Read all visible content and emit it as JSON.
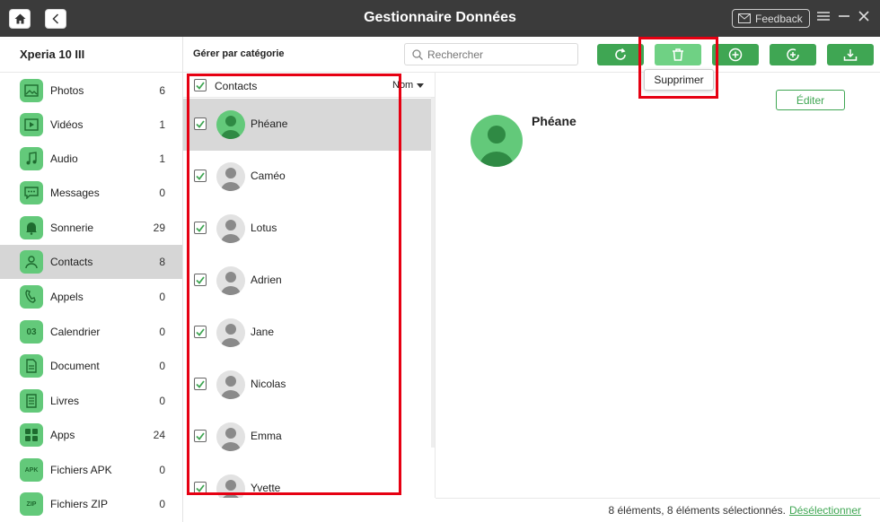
{
  "app": {
    "title": "Gestionnaire Données",
    "feedback_label": "Feedback"
  },
  "sidebar": {
    "device": "Xperia 10 III",
    "items": [
      {
        "label": "Photos",
        "count": "6",
        "icon": "photo-icon"
      },
      {
        "label": "Vidéos",
        "count": "1",
        "icon": "video-icon"
      },
      {
        "label": "Audio",
        "count": "1",
        "icon": "music-icon"
      },
      {
        "label": "Messages",
        "count": "0",
        "icon": "message-icon"
      },
      {
        "label": "Sonnerie",
        "count": "29",
        "icon": "bell-icon"
      },
      {
        "label": "Contacts",
        "count": "8",
        "icon": "contact-icon",
        "active": true
      },
      {
        "label": "Appels",
        "count": "0",
        "icon": "phone-icon"
      },
      {
        "label": "Calendrier",
        "count": "0",
        "icon": "calendar-icon",
        "badge": "03"
      },
      {
        "label": "Document",
        "count": "0",
        "icon": "document-icon"
      },
      {
        "label": "Livres",
        "count": "0",
        "icon": "book-icon"
      },
      {
        "label": "Apps",
        "count": "24",
        "icon": "apps-icon"
      },
      {
        "label": "Fichiers APK",
        "count": "0",
        "icon": "apk-icon",
        "badge": "APK"
      },
      {
        "label": "Fichiers ZIP",
        "count": "0",
        "icon": "zip-icon",
        "badge": "ZIP"
      }
    ]
  },
  "toolbar": {
    "manage_label": "Gérer par catégorie",
    "search_placeholder": "Rechercher",
    "buttons": [
      "refresh-icon",
      "trash-icon",
      "add-icon",
      "add-to-device-icon",
      "export-icon"
    ],
    "tooltip": "Supprimer"
  },
  "list": {
    "header_label": "Contacts",
    "sort_label": "Nom",
    "contacts": [
      {
        "name": "Phéane",
        "selected": true,
        "checked": true
      },
      {
        "name": "Caméo",
        "checked": true
      },
      {
        "name": "Lotus",
        "checked": true
      },
      {
        "name": "Adrien",
        "checked": true
      },
      {
        "name": "Jane",
        "checked": true
      },
      {
        "name": "Nicolas",
        "checked": true
      },
      {
        "name": "Emma",
        "checked": true
      },
      {
        "name": "Yvette",
        "checked": true
      }
    ]
  },
  "detail": {
    "name": "Phéane",
    "edit_label": "Éditer"
  },
  "status": {
    "text": "8 éléments, 8 éléments sélectionnés.",
    "link": "Désélectionner"
  },
  "colors": {
    "accent": "#3fa653",
    "accent_light": "#63c97a",
    "highlight": "#e60012",
    "topbar": "#3b3b3b"
  }
}
